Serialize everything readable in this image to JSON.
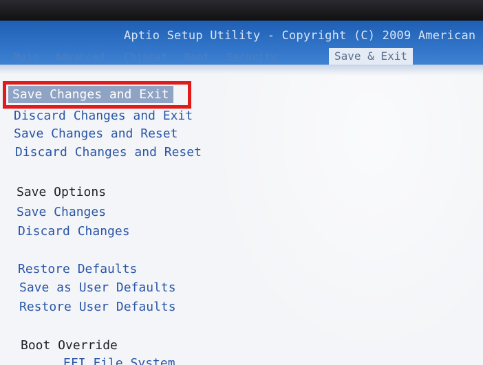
{
  "header": {
    "title": "Aptio Setup Utility - Copyright (C) 2009 American",
    "tabs": [
      {
        "label": "Main"
      },
      {
        "label": "Advanced"
      },
      {
        "label": "Chipset"
      },
      {
        "label": "Boot"
      },
      {
        "label": "Security"
      },
      {
        "label": "Save & Exit"
      }
    ],
    "active_tab": "Save & Exit"
  },
  "menu": {
    "items": [
      {
        "label": "Save Changes and Exit"
      },
      {
        "label": "Discard Changes and Exit"
      },
      {
        "label": "Save Changes and Reset"
      },
      {
        "label": "Discard Changes and Reset"
      },
      {
        "label": "Save Options"
      },
      {
        "label": "Save Changes"
      },
      {
        "label": "Discard Changes"
      },
      {
        "label": "Restore Defaults"
      },
      {
        "label": "Save as User Defaults"
      },
      {
        "label": "Restore User Defaults"
      },
      {
        "label": "Boot Override"
      },
      {
        "label": "EFI File System"
      }
    ],
    "selected": "Save Changes and Exit"
  },
  "colors": {
    "header_blue": "#2f72c6",
    "link_blue": "#2a56a6",
    "highlight_red": "#e11a1a",
    "selected_bg": "#8fa3c4"
  }
}
